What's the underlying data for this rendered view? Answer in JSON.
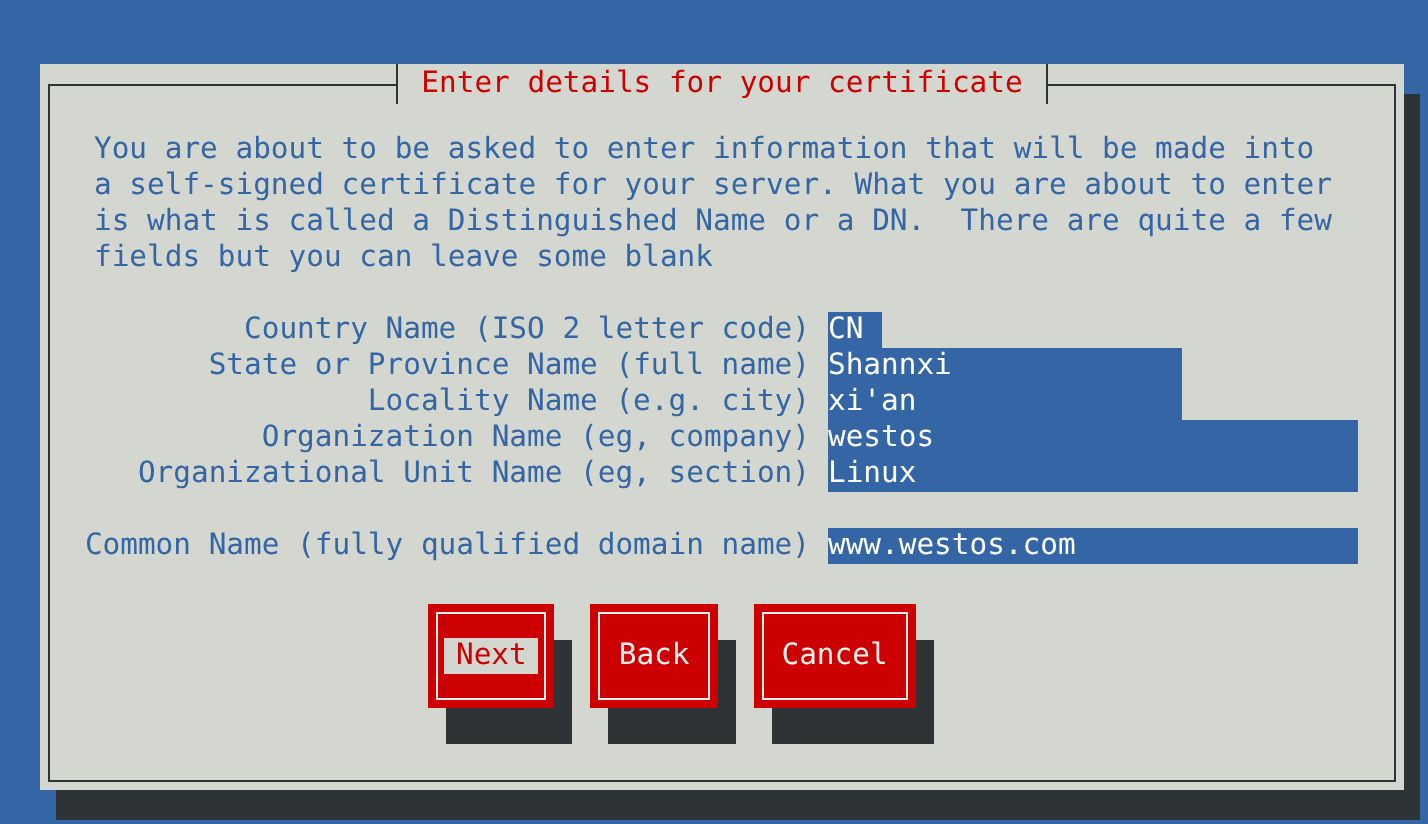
{
  "dialog": {
    "title": "Enter details for your certificate",
    "message": "You are about to be asked to enter information that will be made into\na self-signed certificate for your server. What you are about to enter\nis what is called a Distinguished Name or a DN.  There are quite a few\nfields but you can leave some blank",
    "fields": [
      {
        "label": "Country Name (ISO 2 letter code)",
        "value": "CN",
        "kind": "short"
      },
      {
        "label": "State or Province Name (full name)",
        "value": "Shannxi",
        "kind": "medium"
      },
      {
        "label": "Locality Name (e.g. city)",
        "value": "xi'an",
        "kind": "medium"
      },
      {
        "label": "Organization Name (eg, company)",
        "value": "westos",
        "kind": "long"
      },
      {
        "label": "Organizational Unit Name (eg, section)",
        "value": "Linux",
        "kind": "long"
      },
      {
        "label": "Common Name (fully qualified domain name)",
        "value": "www.westos.com",
        "kind": "long",
        "separated": true
      }
    ],
    "buttons": [
      {
        "label": "Next",
        "selected": true
      },
      {
        "label": "Back",
        "selected": false
      },
      {
        "label": "Cancel",
        "selected": false
      }
    ]
  }
}
